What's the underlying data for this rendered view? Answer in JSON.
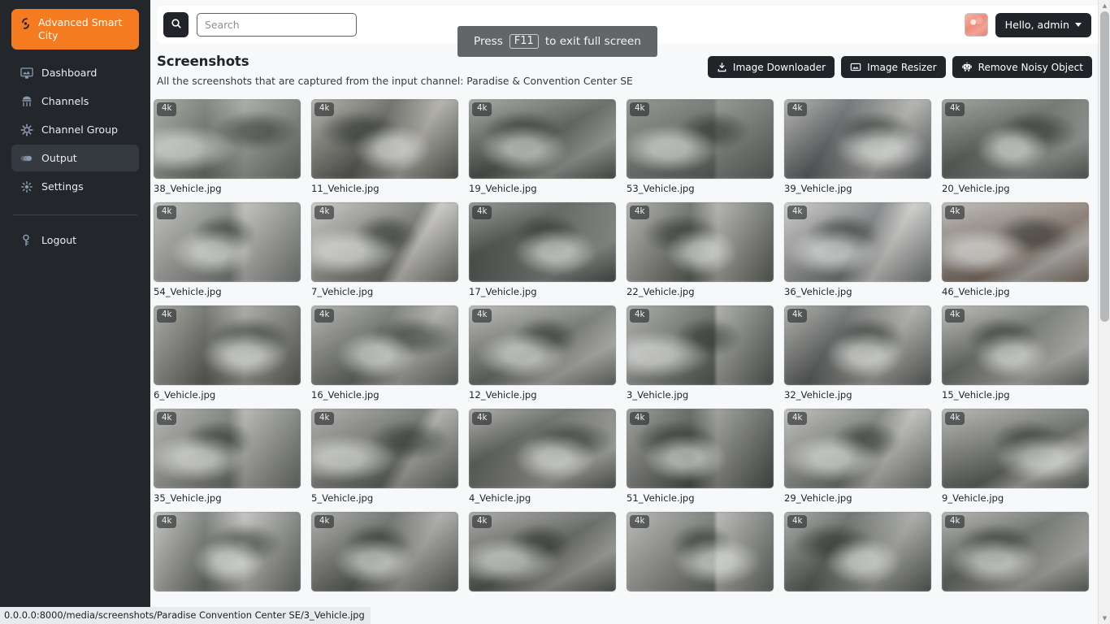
{
  "sidebar": {
    "brand": {
      "label": "Advanced Smart City",
      "icon": "smart-city-logo-icon",
      "color": "#f47b20"
    },
    "items": [
      {
        "label": "Dashboard",
        "icon": "dashboard-monitor-icon",
        "active": false
      },
      {
        "label": "Channels",
        "icon": "channels-network-icon",
        "active": false
      },
      {
        "label": "Channel Group",
        "icon": "channel-group-gear-icon",
        "active": false
      },
      {
        "label": "Output",
        "icon": "output-eye-icon",
        "active": true
      },
      {
        "label": "Settings",
        "icon": "settings-gear-icon",
        "active": false
      }
    ],
    "logout": {
      "label": "Logout",
      "icon": "logout-key-icon"
    }
  },
  "topbar": {
    "search": {
      "placeholder": "Search",
      "value": "",
      "button_icon": "search-icon"
    },
    "user": {
      "greeting": "Hello, admin",
      "avatar_alt": "user-avatar"
    }
  },
  "page": {
    "title": "Screenshots",
    "subtitle": "All the screenshots that are captured from the input channel: Paradise & Convention Center SE",
    "actions": [
      {
        "label": "Image Downloader",
        "icon": "download-icon"
      },
      {
        "label": "Image Resizer",
        "icon": "resize-image-icon"
      },
      {
        "label": "Remove Noisy Object",
        "icon": "robot-icon"
      }
    ]
  },
  "toast": {
    "prefix": "Press",
    "key": "F11",
    "suffix": "to exit full screen"
  },
  "statusbar": {
    "url": "0.0.0.0:8000/media/screenshots/Paradise  Convention Center SE/3_Vehicle.jpg"
  },
  "scrollbar": {
    "position": "top",
    "visible": true
  },
  "gallery": {
    "badge_label": "4k",
    "items": [
      {
        "name": "38_Vehicle.jpg",
        "badge": "4k",
        "tone": "#9aa094",
        "tone2": "#6c7366"
      },
      {
        "name": "11_Vehicle.jpg",
        "badge": "4k",
        "tone": "#a9a79c",
        "tone2": "#595c52"
      },
      {
        "name": "19_Vehicle.jpg",
        "badge": "4k",
        "tone": "#93998f",
        "tone2": "#51564c"
      },
      {
        "name": "53_Vehicle.jpg",
        "badge": "4k",
        "tone": "#7e857c",
        "tone2": "#5f665e"
      },
      {
        "name": "39_Vehicle.jpg",
        "badge": "4k",
        "tone": "#a8aaa3",
        "tone2": "#5d6166"
      },
      {
        "name": "20_Vehicle.jpg",
        "badge": "4k",
        "tone": "#8d938c",
        "tone2": "#5c6359"
      },
      {
        "name": "54_Vehicle.jpg",
        "badge": "4k",
        "tone": "#b4b6b0",
        "tone2": "#7c807c"
      },
      {
        "name": "7_Vehicle.jpg",
        "badge": "4k",
        "tone": "#c3c2ba",
        "tone2": "#6f7269"
      },
      {
        "name": "17_Vehicle.jpg",
        "badge": "4k",
        "tone": "#7f8680",
        "tone2": "#4a504b"
      },
      {
        "name": "22_Vehicle.jpg",
        "badge": "4k",
        "tone": "#a5a79f",
        "tone2": "#5d6159"
      },
      {
        "name": "36_Vehicle.jpg",
        "badge": "4k",
        "tone": "#c6c8c3",
        "tone2": "#75797a"
      },
      {
        "name": "46_Vehicle.jpg",
        "badge": "4k",
        "tone": "#b3b1ab",
        "tone2": "#85705f"
      },
      {
        "name": "6_Vehicle.jpg",
        "badge": "4k",
        "tone": "#9a9c93",
        "tone2": "#5f6358"
      },
      {
        "name": "16_Vehicle.jpg",
        "badge": "4k",
        "tone": "#a6a8a2",
        "tone2": "#686c66"
      },
      {
        "name": "12_Vehicle.jpg",
        "badge": "4k",
        "tone": "#aeb0aa",
        "tone2": "#6b6f68"
      },
      {
        "name": "3_Vehicle.jpg",
        "badge": "4k",
        "tone": "#9ea19a",
        "tone2": "#585c55"
      },
      {
        "name": "32_Vehicle.jpg",
        "badge": "4k",
        "tone": "#a3a59f",
        "tone2": "#5e6260"
      },
      {
        "name": "15_Vehicle.jpg",
        "badge": "4k",
        "tone": "#b0b2ac",
        "tone2": "#6a6e67"
      },
      {
        "name": "35_Vehicle.jpg",
        "badge": "4k",
        "tone": "#a9aba5",
        "tone2": "#6e726b"
      },
      {
        "name": "5_Vehicle.jpg",
        "badge": "4k",
        "tone": "#a2a49e",
        "tone2": "#62665f"
      },
      {
        "name": "4_Vehicle.jpg",
        "badge": "4k",
        "tone": "#9fa19b",
        "tone2": "#5a5e57"
      },
      {
        "name": "51_Vehicle.jpg",
        "badge": "4k",
        "tone": "#8c8f89",
        "tone2": "#4c5049"
      },
      {
        "name": "29_Vehicle.jpg",
        "badge": "4k",
        "tone": "#b6b8b2",
        "tone2": "#72766f"
      },
      {
        "name": "9_Vehicle.jpg",
        "badge": "4k",
        "tone": "#aaaca6",
        "tone2": "#5f635c"
      },
      {
        "name": "",
        "badge": "4k",
        "tone": "#b8bab4",
        "tone2": "#6d716a"
      },
      {
        "name": "",
        "badge": "4k",
        "tone": "#a0a29c",
        "tone2": "#5c6059"
      },
      {
        "name": "",
        "badge": "4k",
        "tone": "#9b9d97",
        "tone2": "#555952"
      },
      {
        "name": "",
        "badge": "4k",
        "tone": "#acaea8",
        "tone2": "#686c65"
      },
      {
        "name": "",
        "badge": "4k",
        "tone": "#9da09a",
        "tone2": "#5a5e58"
      },
      {
        "name": "",
        "badge": "4k",
        "tone": "#a7a9a3",
        "tone2": "#63675f"
      }
    ]
  }
}
